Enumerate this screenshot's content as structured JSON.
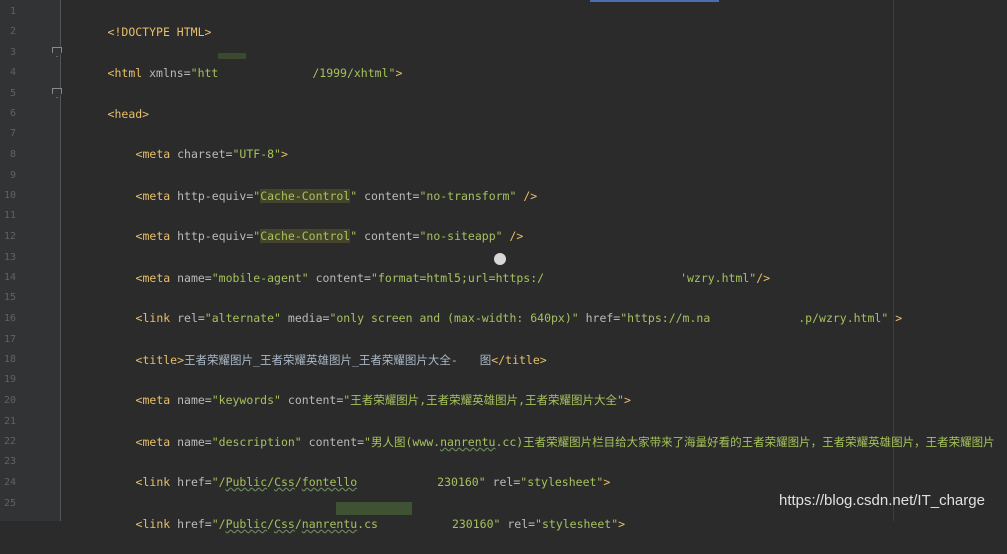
{
  "editor": {
    "watermark": "https://blog.csdn.net/IT_charge",
    "lines": [
      {
        "n": "1"
      },
      {
        "n": "2"
      },
      {
        "n": "3"
      },
      {
        "n": "4"
      },
      {
        "n": "5"
      },
      {
        "n": "6"
      },
      {
        "n": "7"
      },
      {
        "n": "8"
      },
      {
        "n": "9"
      },
      {
        "n": "10"
      },
      {
        "n": "11"
      },
      {
        "n": "12"
      },
      {
        "n": "13"
      },
      {
        "n": "14"
      },
      {
        "n": "15"
      },
      {
        "n": "16"
      },
      {
        "n": "17"
      },
      {
        "n": "18"
      },
      {
        "n": "19"
      },
      {
        "n": "20"
      },
      {
        "n": "21"
      },
      {
        "n": "22"
      },
      {
        "n": "23"
      },
      {
        "n": "24"
      },
      {
        "n": "25"
      }
    ],
    "code": {
      "l1": {
        "lt": "<",
        "doctype": "!DOCTYPE HTML",
        "gt": ">"
      },
      "l3": {
        "open": "<html",
        "attr": " xmlns=",
        "val_a": "\"htt",
        "val_b": "/1999/xhtml\"",
        "close": ">"
      },
      "l5": {
        "tag": "<head>"
      },
      "l7": {
        "open": "<meta",
        "attr": " charset=",
        "val": "\"UTF-8\"",
        "close": ">"
      },
      "l9": {
        "open": "<meta",
        "attr1": " http-equiv=",
        "q1": "\"",
        "hv": "Cache-Control",
        "q2": "\"",
        "attr2": " content=",
        "val2": "\"no-transform\"",
        "close": " />"
      },
      "l11": {
        "open": "<meta",
        "attr1": " http-equiv=",
        "q1": "\"",
        "hv": "Cache-Control",
        "q2": "\"",
        "attr2": " content=",
        "val2": "\"no-siteapp\"",
        "close": " />"
      },
      "l13": {
        "open": "<meta",
        "attr1": " name=",
        "val1": "\"mobile-agent\"",
        "attr2": " content=",
        "val2a": "\"format=html5;url=https:/",
        "val2b": "'wzry.html\"",
        "close": "/>"
      },
      "l15": {
        "open": "<link",
        "attr1": " rel=",
        "val1": "\"alternate\"",
        "attr2": " media=",
        "val2": "\"only screen and (max-width: 640px)\"",
        "attr3": " href=",
        "val3a": "\"https://m.na",
        "val3b": ".p/wzry.html\"",
        "close": " >"
      },
      "l17": {
        "open": "<title>",
        "text_a": "王者荣耀图片_王者荣耀英雄图片_王者荣耀图片大全-",
        "text_b": "图",
        "close": "</title>"
      },
      "l19": {
        "open": "<meta",
        "attr1": " name=",
        "val1": "\"keywords\"",
        "attr2": " content=",
        "val2": "\"王者荣耀图片,王者荣耀英雄图片,王者荣耀图片大全\"",
        "close": ">"
      },
      "l21": {
        "open": "<meta",
        "attr1": " name=",
        "val1": "\"description\"",
        "attr2": " content=",
        "val2a": "\"男人图(www.",
        "val2u": "nanrentu",
        "val2b": ".cc)王者荣耀图片栏目给大家带来了海量好看的王者荣耀图片，王者荣耀英雄图片，王者荣耀图片"
      },
      "l23": {
        "open": "<link",
        "attr1": " href=",
        "val1a": "\"/",
        "u1": "Public",
        "s1": "/",
        "u2": "Css",
        "s2": "/",
        "u3": "fontello",
        "val1b": "230160\"",
        "attr2": " rel=",
        "val2": "\"stylesheet\"",
        "close": ">"
      },
      "l25": {
        "open": "<link",
        "attr1": " href=",
        "val1a": "\"/",
        "u1": "Public",
        "s1": "/",
        "u2": "Css",
        "s2": "/",
        "u3": "nanrentu",
        "val1c": ".cs",
        "val1b": "230160\"",
        "attr2": " rel=",
        "val2": "\"stylesheet\"",
        "close": ">"
      }
    }
  }
}
